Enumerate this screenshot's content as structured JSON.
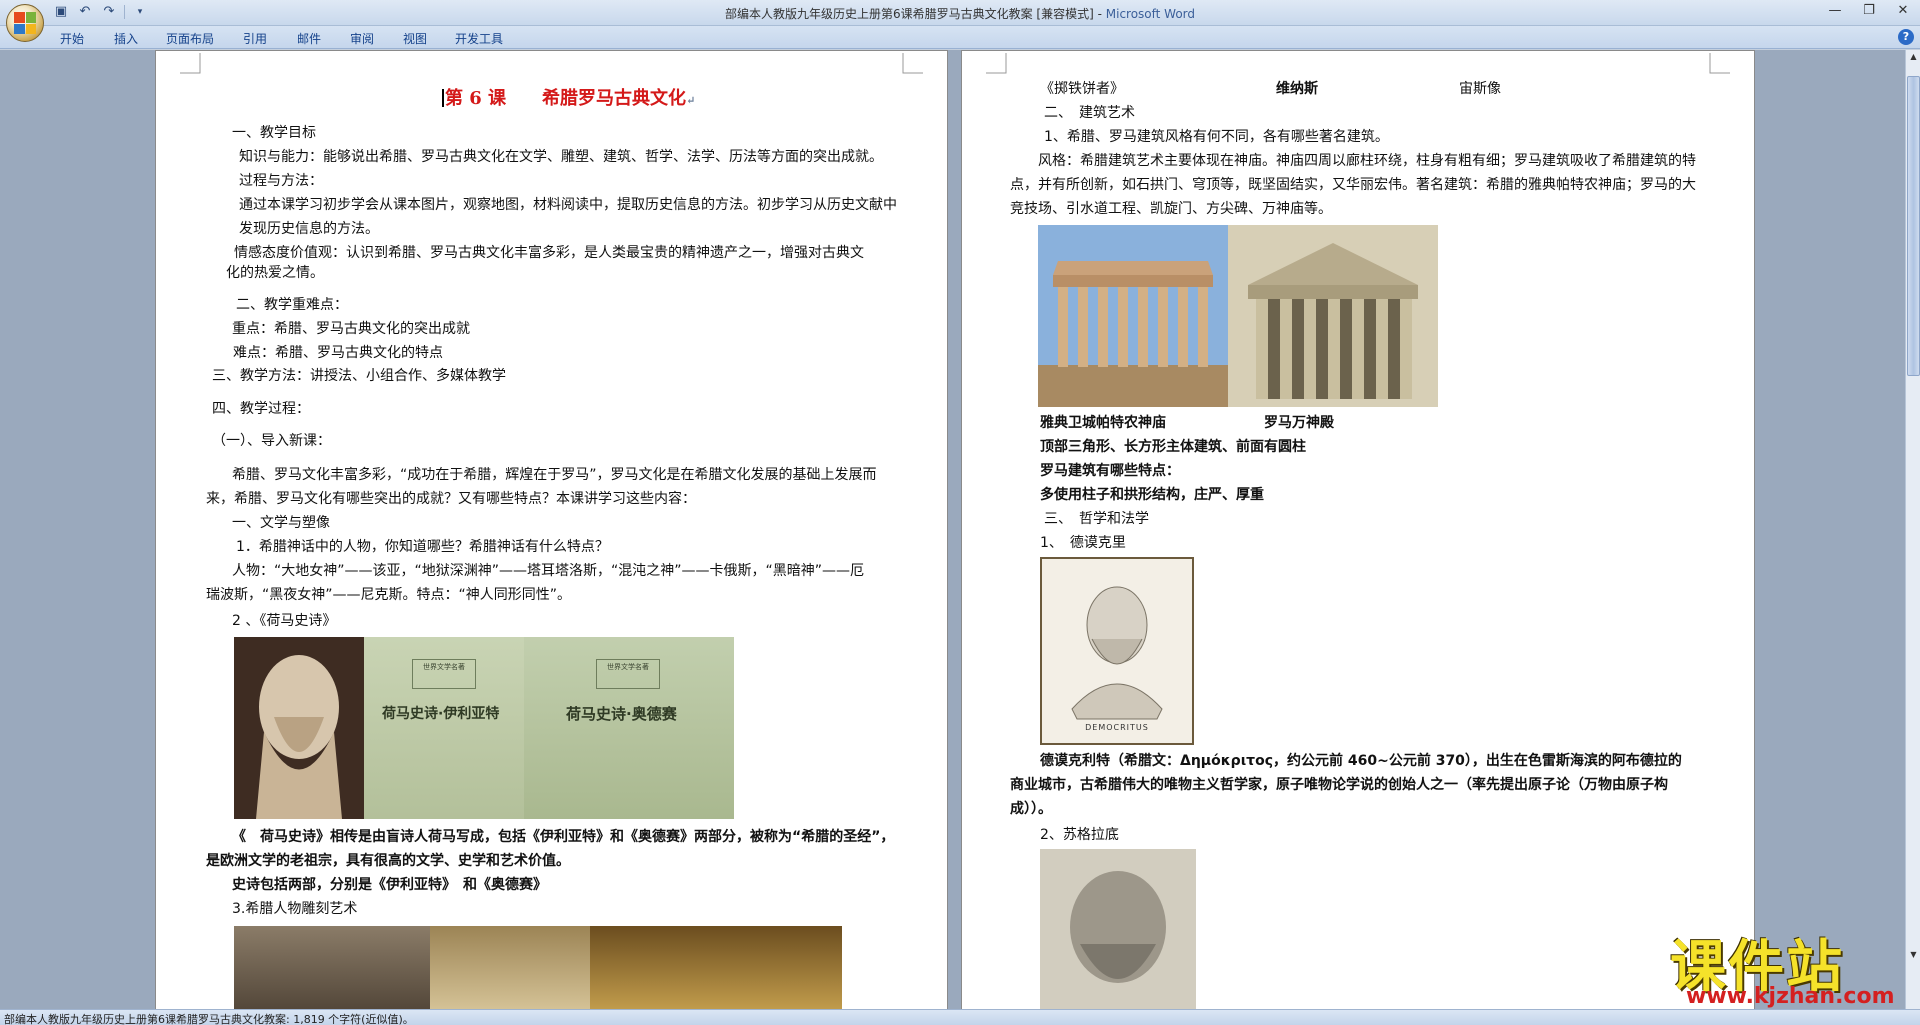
{
  "window": {
    "title_doc": "部编本人教版九年级历史上册第6课希腊罗马古典文化教案 [兼容模式] - ",
    "title_app": "Microsoft Word"
  },
  "qat": {
    "save_icon": "save-icon",
    "undo_icon": "undo-icon",
    "redo_icon": "redo-icon"
  },
  "ribbon": {
    "tabs": [
      {
        "label": "开始"
      },
      {
        "label": "插入"
      },
      {
        "label": "页面布局"
      },
      {
        "label": "引用"
      },
      {
        "label": "邮件"
      },
      {
        "label": "审阅"
      },
      {
        "label": "视图"
      },
      {
        "label": "开发工具"
      }
    ],
    "help": "?"
  },
  "left_page": {
    "title": "第 6 课　　希腊罗马古典文化",
    "lines": [
      "一、教学目标",
      "知识与能力：能够说出希腊、罗马古典文化在文学、雕塑、建筑、哲学、法学、历法等方面的突出成就。",
      "过程与方法：",
      "通过本课学习初步学会从课本图片，观察地图，材料阅读中，提取历史信息的方法。初步学习从历史文献中",
      "发现历史信息的方法。",
      "情感态度价值观：认识到希腊、罗马古典文化丰富多彩，是人类最宝贵的精神遗产之一，增强对古典文",
      "化的热爱之情。",
      "二、教学重难点：",
      "重点：希腊、罗马古典文化的突出成就",
      "难点：希腊、罗马古典文化的特点",
      "三、教学方法：讲授法、小组合作、多媒体教学",
      "四、教学过程：",
      "（一）、导入新课：",
      "希腊、罗马文化丰富多彩，“成功在于希腊，辉煌在于罗马”，罗马文化是在希腊文化发展的基础上发展而",
      "来，希腊、罗马文化有哪些突出的成就？又有哪些特点？本课讲学习这些内容：",
      "一、文学与塑像",
      "1．希腊神话中的人物，你知道哪些？希腊神话有什么特点？",
      "人物：“大地女神”——该亚，“地狱深渊神”——塔耳塔洛斯，“混沌之神”——卡俄斯，“黑暗神”——厄",
      "瑞波斯，“黑夜女神”——尼克斯。特点：“神人同形同性”。",
      "2 、《荷马史诗》",
      "《　荷马史诗》相传是由盲诗人荷马写成，包括《伊利亚特》和《奥德赛》两部分，被称为“希腊的圣经”，",
      "是欧洲文学的老祖宗，具有很高的文学、史学和艺术价值。",
      "史诗包括两部，分别是《伊利亚特》　和《奥德赛》",
      "3.希腊人物雕刻艺术"
    ],
    "book1": "荷马史诗·伊利亚特",
    "book2": "荷马史诗·奥德赛",
    "book_series": "世界文学名著"
  },
  "right_page": {
    "lines": [
      "《掷铁饼者》",
      "维纳斯",
      "宙斯像",
      "二、　建筑艺术",
      "1、希腊、罗马建筑风格有何不同，各有哪些著名建筑。",
      "风格：希腊建筑艺术主要体现在神庙。神庙四周以廊柱环绕，柱身有粗有细；罗马建筑吸收了希腊建筑的特",
      "点，并有所创新，如石拱门、穹顶等，既坚固结实，又华丽宏伟。著名建筑：希腊的雅典帕特农神庙；罗马的大",
      "竞技场、引水道工程、凯旋门、方尖碑、万神庙等。",
      "雅典卫城帕特农神庙",
      "罗马万神殿",
      "顶部三角形、长方形主体建筑、前面有圆柱",
      "罗马建筑有哪些特点：",
      "多使用柱子和拱形结构，庄严、厚重",
      "三、　哲学和法学",
      "1、　德谟克里",
      "德谟克利特（希腊文：Δημόκριτος，约公元前 460~公元前 370），出生在色雷斯海滨的阿布德拉的",
      "商业城市，古希腊伟大的唯物主义哲学家，原子唯物论学说的创始人之一（率先提出原子论（万物由原子构",
      "成））。",
      "2、苏格拉底"
    ],
    "bust_caption": "DEMOCRITUS"
  },
  "statusbar": {
    "text": "部编本人教版九年级历史上册第6课希腊罗马古典文化教案: 1,819 个字符(近似值)。"
  },
  "watermark": {
    "cn": "课件站",
    "url": "www.kjzhan.com"
  },
  "colors": {
    "title_red": "#d41919",
    "ribbon_text": "#15428b",
    "workspace": "#9aa9bd"
  }
}
